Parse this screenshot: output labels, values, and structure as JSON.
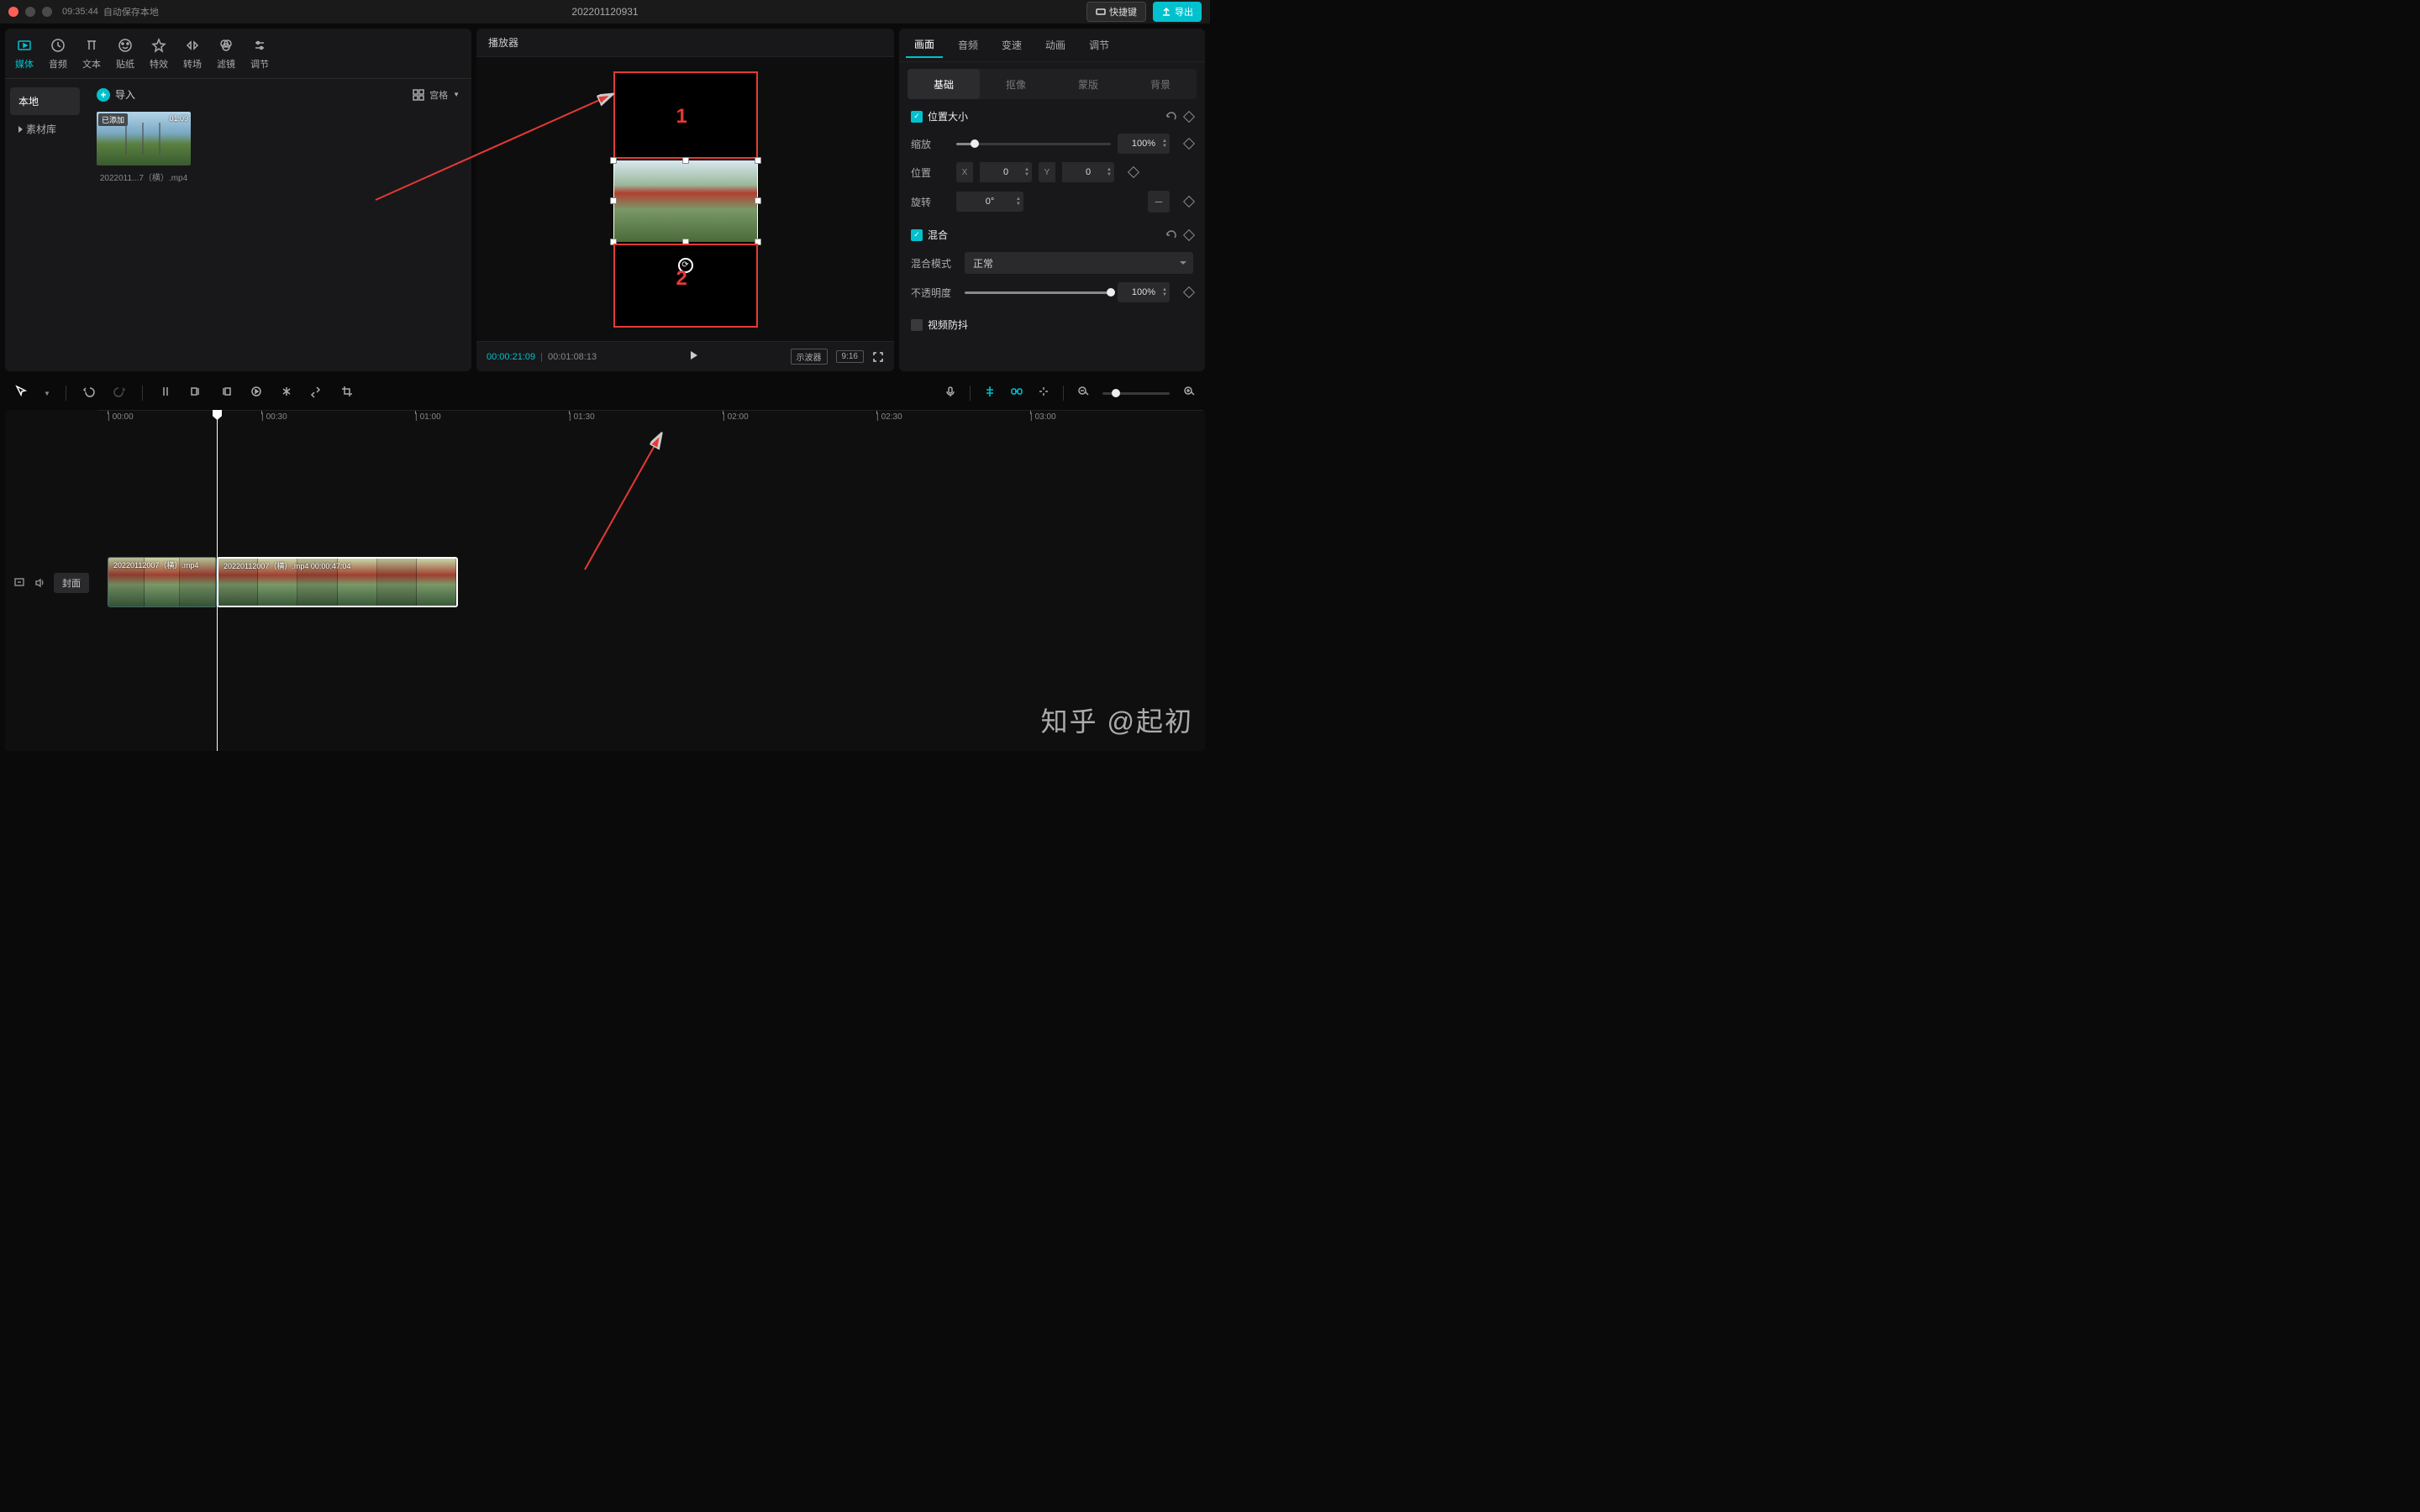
{
  "titlebar": {
    "time": "09:35:44",
    "autosave": "自动保存本地",
    "project": "202201120931",
    "shortcut": "快捷键",
    "export": "导出"
  },
  "media": {
    "tabs": [
      "媒体",
      "音频",
      "文本",
      "贴纸",
      "特效",
      "转场",
      "滤镜",
      "调节"
    ],
    "sidebar": {
      "local": "本地",
      "library": "素材库"
    },
    "import": "导入",
    "view_mode": "宫格",
    "clip": {
      "badge": "已添加",
      "duration": "01:09",
      "name": "2022011...7（横）.mp4"
    }
  },
  "player": {
    "title": "播放器",
    "current": "00:00:21:09",
    "duration": "00:01:08:13",
    "scope": "示波器",
    "ratio": "9:16"
  },
  "annot": {
    "box1": "1",
    "box2": "2"
  },
  "inspector": {
    "tabs": [
      "画面",
      "音频",
      "变速",
      "动画",
      "调节"
    ],
    "subtabs": [
      "基础",
      "抠像",
      "蒙版",
      "背景"
    ],
    "pos_size": "位置大小",
    "scale": "缩放",
    "scale_val": "100%",
    "position": "位置",
    "pos_x": "0",
    "pos_y": "0",
    "rotate": "旋转",
    "rotate_val": "0°",
    "blend": "混合",
    "blend_mode_label": "混合模式",
    "blend_mode": "正常",
    "opacity": "不透明度",
    "opacity_val": "100%",
    "stabilize": "视频防抖"
  },
  "timeline": {
    "ticks": [
      "00:00",
      "00:30",
      "01:00",
      "01:30",
      "02:00",
      "02:30",
      "03:00"
    ],
    "cover": "封面",
    "clip1": "20220112007（横）.mp4",
    "clip2": "20220112007（横）.mp4   00:00:47:04"
  },
  "watermark": "知乎 @起初"
}
